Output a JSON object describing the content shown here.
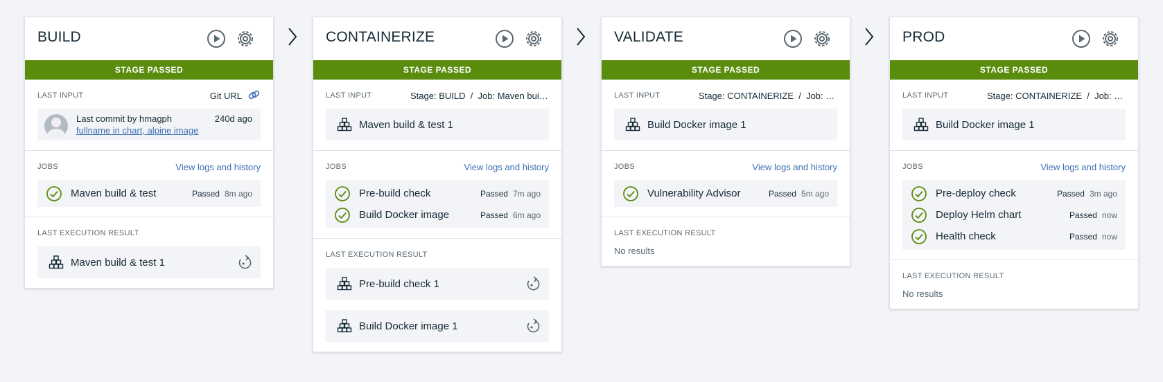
{
  "colors": {
    "passed": "#5a8d0d",
    "link": "#3d70b2",
    "text": "#152935",
    "muted": "#5a6872"
  },
  "icons": {
    "run": "play-icon",
    "configure": "gear-icon",
    "next": "chevron-right-icon",
    "job_passed": "check-circle-icon",
    "artifact": "blocks-icon",
    "rerun": "redo-icon"
  },
  "stages": [
    {
      "title": "BUILD",
      "status": "STAGE PASSED",
      "last_input": {
        "label": "LAST INPUT",
        "source": "Git URL",
        "commit_by": "Last commit by hmagph",
        "commit_msg": "fullname in chart, alpine image",
        "commit_age": "240d ago"
      },
      "jobs": {
        "label": "JOBS",
        "link": "View logs and history",
        "items": [
          {
            "name": "Maven build & test",
            "status": "Passed",
            "time": "8m ago"
          }
        ]
      },
      "result": {
        "label": "LAST EXECUTION RESULT",
        "items": [
          {
            "name": "Maven build & test 1"
          }
        ]
      }
    },
    {
      "title": "CONTAINERIZE",
      "status": "STAGE PASSED",
      "last_input": {
        "label": "LAST INPUT",
        "source": "Stage: BUILD  /  Job: Maven build & test",
        "name": "Maven build & test 1"
      },
      "jobs": {
        "label": "JOBS",
        "link": "View logs and history",
        "items": [
          {
            "name": "Pre-build check",
            "status": "Passed",
            "time": "7m ago"
          },
          {
            "name": "Build Docker image",
            "status": "Passed",
            "time": "6m ago"
          }
        ]
      },
      "result": {
        "label": "LAST EXECUTION RESULT",
        "items": [
          {
            "name": "Pre-build check 1"
          },
          {
            "name": "Build Docker image 1"
          }
        ]
      }
    },
    {
      "title": "VALIDATE",
      "status": "STAGE PASSED",
      "last_input": {
        "label": "LAST INPUT",
        "source": "Stage: CONTAINERIZE  /  Job: Build Docker image",
        "name": "Build Docker image 1"
      },
      "jobs": {
        "label": "JOBS",
        "link": "View logs and history",
        "items": [
          {
            "name": "Vulnerability Advisor",
            "status": "Passed",
            "time": "5m ago"
          }
        ]
      },
      "result": {
        "label": "LAST EXECUTION RESULT",
        "empty": "No results"
      }
    },
    {
      "title": "PROD",
      "status": "STAGE PASSED",
      "last_input": {
        "label": "LAST INPUT",
        "source": "Stage: CONTAINERIZE  /  Job: Build Docker image",
        "name": "Build Docker image 1"
      },
      "jobs": {
        "label": "JOBS",
        "link": "View logs and history",
        "items": [
          {
            "name": "Pre-deploy check",
            "status": "Passed",
            "time": "3m ago"
          },
          {
            "name": "Deploy Helm chart",
            "status": "Passed",
            "time": "now"
          },
          {
            "name": "Health check",
            "status": "Passed",
            "time": "now"
          }
        ]
      },
      "result": {
        "label": "LAST EXECUTION RESULT",
        "empty": "No results"
      }
    }
  ]
}
